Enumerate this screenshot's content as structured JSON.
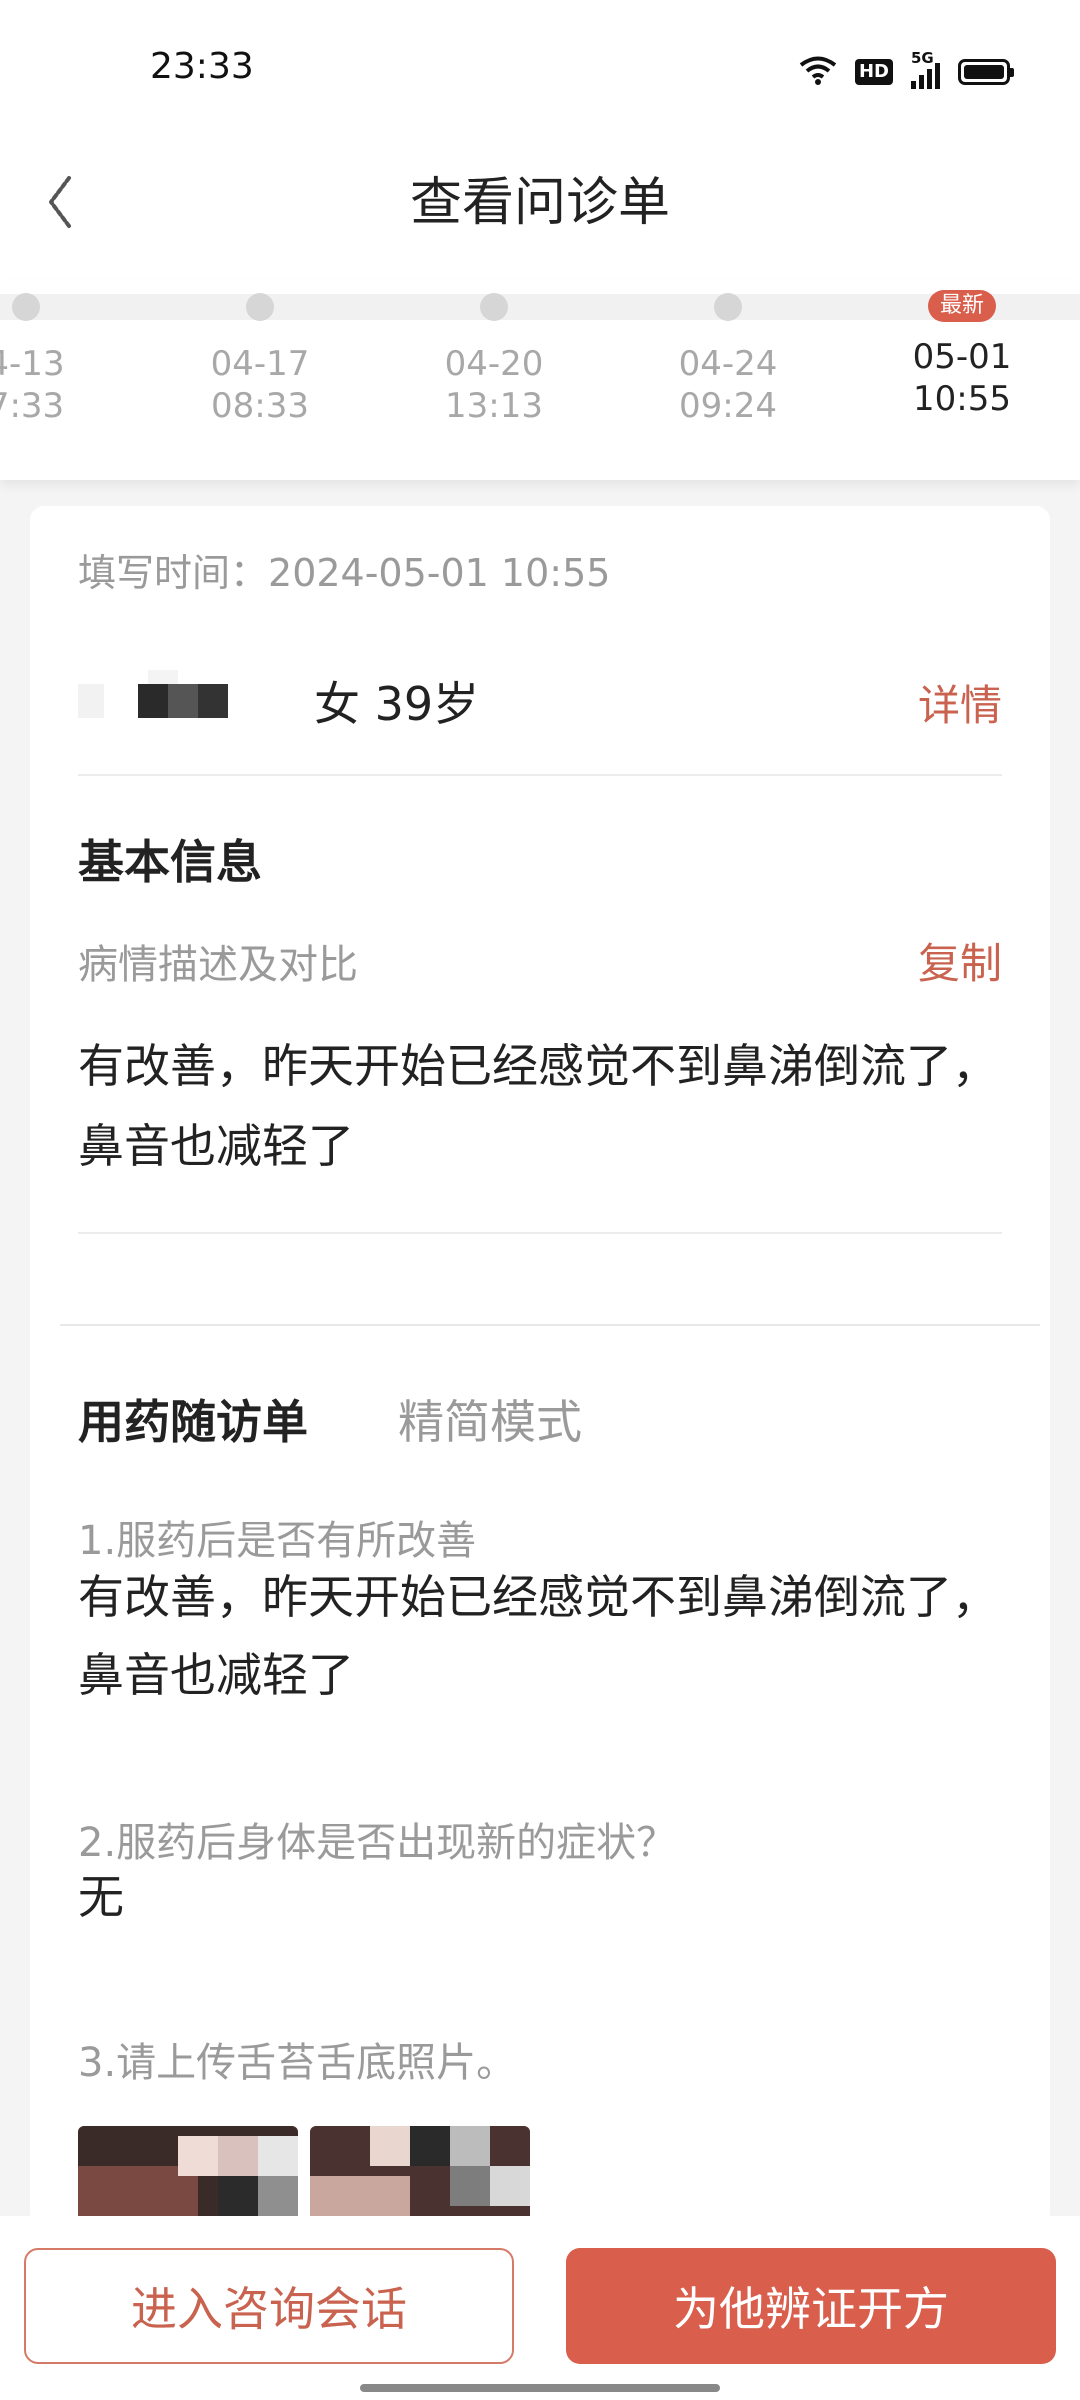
{
  "status_bar": {
    "time": "23:33",
    "network": "5G",
    "hd_label": "HD",
    "icons": [
      "wifi-icon",
      "hd-icon",
      "signal-5g-icon",
      "battery-icon"
    ]
  },
  "header": {
    "title": "查看问诊单",
    "back_icon": "back-arrow-icon"
  },
  "timeline": {
    "items": [
      {
        "date": "4-13",
        "time": "7:33",
        "active": false
      },
      {
        "date": "04-17",
        "time": "08:33",
        "active": false
      },
      {
        "date": "04-20",
        "time": "13:13",
        "active": false
      },
      {
        "date": "04-24",
        "time": "09:24",
        "active": false
      },
      {
        "date": "05-01",
        "time": "10:55",
        "active": true,
        "badge": "最新"
      }
    ]
  },
  "card": {
    "fill_time_label": "填写时间：",
    "fill_time_value": "2024-05-01 10:55",
    "patient": {
      "info": "女 39岁",
      "detail_link": "详情"
    },
    "basic_info": {
      "title": "基本信息",
      "label": "病情描述及对比",
      "copy_link": "复制",
      "description": "有改善，昨天开始已经感觉不到鼻涕倒流了，鼻音也减轻了"
    },
    "followup": {
      "tab_active": "用药随访单",
      "tab_inactive": "精简模式",
      "questions": [
        {
          "q": "1.服药后是否有所改善",
          "a": "有改善，昨天开始已经感觉不到鼻涕倒流了，鼻音也减轻了"
        },
        {
          "q": "2.服药后身体是否出现新的症状？",
          "a": "无"
        },
        {
          "q": "3.请上传舌苔舌底照片。",
          "a": ""
        }
      ]
    }
  },
  "bottom": {
    "consult_button": "进入咨询会话",
    "prescribe_button": "为他辨证开方"
  },
  "colors": {
    "accent": "#d95e4c",
    "link": "#c9634f",
    "muted": "#9a9a9a"
  }
}
